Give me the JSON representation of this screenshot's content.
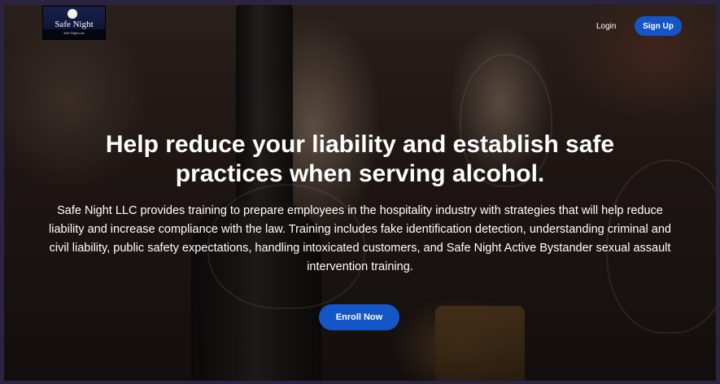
{
  "logo": {
    "name": "Safe Night",
    "sub": "Safe-Night.com"
  },
  "nav": {
    "login_label": "Login",
    "signup_label": "Sign Up"
  },
  "hero": {
    "headline_line1": "Help reduce your liability and establish safe",
    "headline_line2": "practices when serving alcohol.",
    "description": "Safe Night LLC provides training to prepare employees in the hospitality industry with strategies that will help reduce liability and increase compliance with the law. Training includes fake identification detection, understanding criminal and civil liability, public safety expectations, handling intoxicated customers, and Safe Night Active Bystander sexual assault intervention training.",
    "cta_label": "Enroll Now"
  },
  "colors": {
    "accent": "#1456c8",
    "page_frame": "#2a2440"
  }
}
